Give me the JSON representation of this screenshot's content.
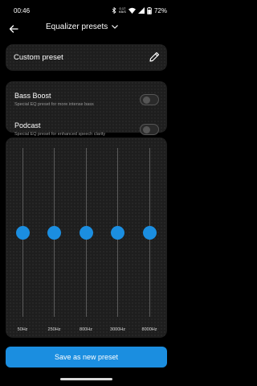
{
  "status_bar": {
    "time": "00:46",
    "net_speed_value": "0.17",
    "net_speed_unit": "KB/S",
    "battery": "72%"
  },
  "header": {
    "title": "Equalizer presets",
    "back_icon": "arrow-left-icon",
    "dropdown_icon": "chevron-down-icon"
  },
  "custom_preset": {
    "label": "Custom preset",
    "edit_icon": "pencil-icon"
  },
  "presets": [
    {
      "title": "Bass Boost",
      "description": "Special EQ preset for more intense bass",
      "enabled": false
    },
    {
      "title": "Podcast",
      "description": "Special EQ preset for enhanced speech clarity",
      "enabled": false
    }
  ],
  "equalizer": {
    "bands": [
      {
        "label": "50Hz",
        "level": 0.5
      },
      {
        "label": "250Hz",
        "level": 0.5
      },
      {
        "label": "800Hz",
        "level": 0.5
      },
      {
        "label": "3000Hz",
        "level": 0.5
      },
      {
        "label": "8000Hz",
        "level": 0.5
      }
    ]
  },
  "save_button": {
    "label": "Save as new preset"
  },
  "colors": {
    "accent": "#1b8ee0",
    "card": "#1e1e1e",
    "background": "#000000"
  }
}
